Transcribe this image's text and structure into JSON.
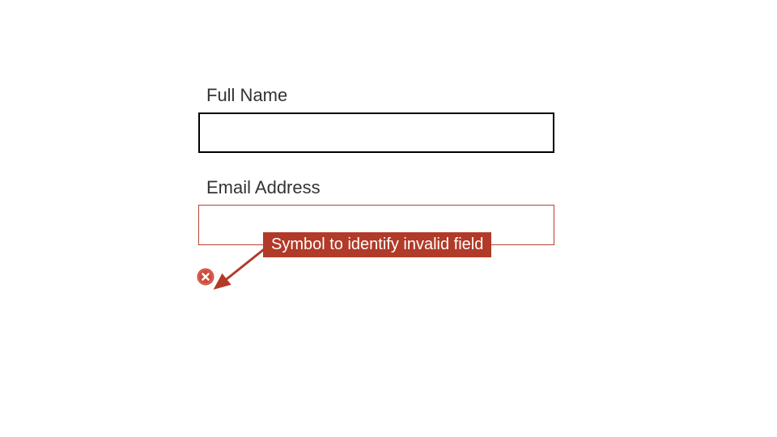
{
  "form": {
    "fields": [
      {
        "label": "Full Name",
        "value": "",
        "invalid": false
      },
      {
        "label": "Email Address",
        "value": "",
        "invalid": true
      }
    ]
  },
  "callout": {
    "text": "Symbol to identify invalid field"
  },
  "colors": {
    "error": "#b13a28",
    "error_icon": "#d04a3a"
  }
}
